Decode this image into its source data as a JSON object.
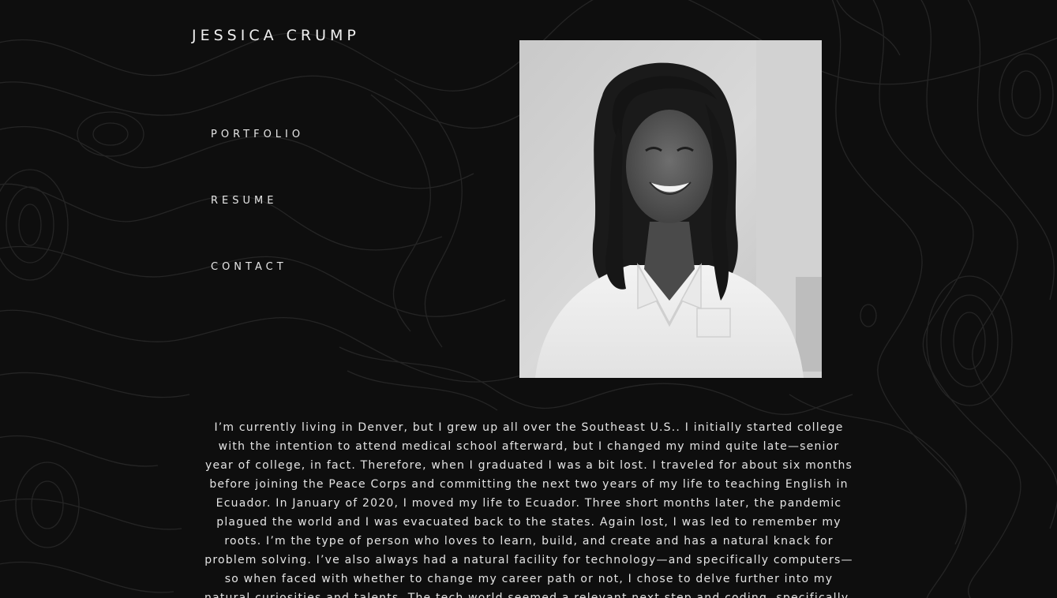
{
  "site": {
    "title": "JESSICA CRUMP"
  },
  "nav": {
    "items": [
      {
        "label": "PORTFOLIO"
      },
      {
        "label": "RESUME"
      },
      {
        "label": "CONTACT"
      }
    ]
  },
  "profile_photo": {
    "description": "black-and-white-portrait"
  },
  "bio": {
    "text": "I’m currently living in Denver, but I grew up all over the Southeast U.S.. I initially started college with the intention to attend medical school afterward, but I changed my mind quite late—senior year of college, in fact. Therefore, when I graduated I was a bit lost. I traveled for about six months before joining the Peace Corps and committing the next two years of my life to teaching English in Ecuador. In January of 2020, I moved my life to Ecuador. Three short months later, the pandemic plagued the world and I was evacuated back to the states. Again lost, I was led to remember my roots. I’m the type of person who loves to learn, build, and create and has a natural knack for problem solving. I’ve also always had a natural facility for technology—and specifically computers—so when faced with whether to change my career path or not, I chose to delve further into my natural curiosities and talents. The tech world seemed a relevant next step and coding, specifically, seemed to check all the boxes. I taught myself much of the fundamentals - html,"
  },
  "colors": {
    "background": "#0e0e0e",
    "text": "#e8e8e8",
    "topo_lines": "#262626"
  }
}
